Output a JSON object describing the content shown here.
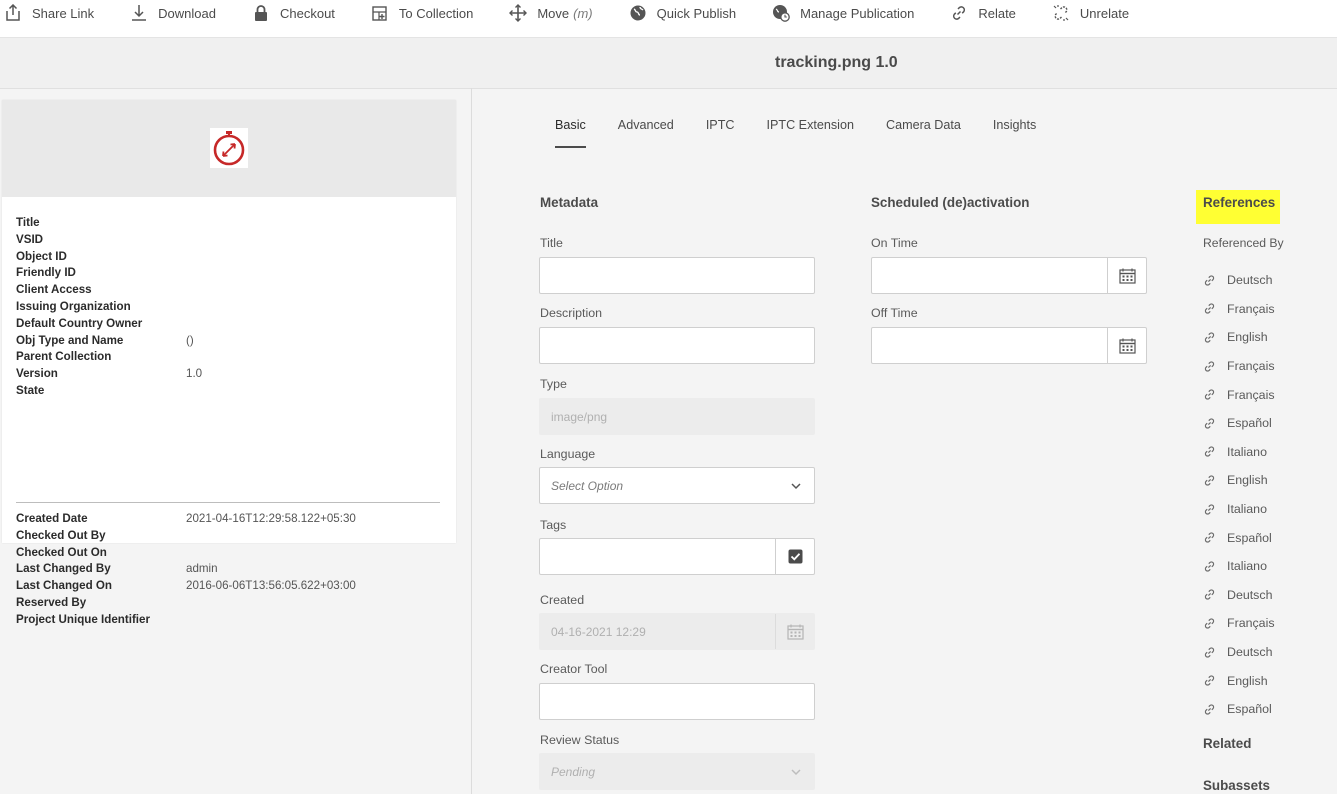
{
  "toolbar": {
    "share_link": "Share Link",
    "download": "Download",
    "checkout": "Checkout",
    "to_collection": "To Collection",
    "move": "Move",
    "move_hint": "(m)",
    "quick_publish": "Quick Publish",
    "manage_publication": "Manage Publication",
    "relate": "Relate",
    "unrelate": "Unrelate"
  },
  "header": {
    "title": "tracking.png 1.0"
  },
  "asset": {
    "thumbnail_icon": "stopwatch-icon",
    "properties": [
      {
        "label": "Title",
        "value": ""
      },
      {
        "label": "VSID",
        "value": ""
      },
      {
        "label": "Object ID",
        "value": ""
      },
      {
        "label": "Friendly ID",
        "value": ""
      },
      {
        "label": "Client Access",
        "value": ""
      },
      {
        "label": "Issuing Organization",
        "value": ""
      },
      {
        "label": "Default Country Owner",
        "value": ""
      },
      {
        "label": "Obj Type and Name",
        "value": "()"
      },
      {
        "label": "Parent Collection",
        "value": ""
      },
      {
        "label": "Version",
        "value": "1.0"
      },
      {
        "label": "State",
        "value": ""
      }
    ],
    "history": [
      {
        "label": "Created Date",
        "value": "2021-04-16T12:29:58.122+05:30"
      },
      {
        "label": "Checked Out By",
        "value": ""
      },
      {
        "label": "Checked Out On",
        "value": ""
      },
      {
        "label": "Last Changed By",
        "value": "admin"
      },
      {
        "label": "Last Changed On",
        "value": "2016-06-06T13:56:05.622+03:00"
      },
      {
        "label": "Reserved By",
        "value": ""
      },
      {
        "label": "Project Unique Identifier",
        "value": ""
      }
    ]
  },
  "tabs": [
    "Basic",
    "Advanced",
    "IPTC",
    "IPTC Extension",
    "Camera Data",
    "Insights"
  ],
  "active_tab": "Basic",
  "metadata": {
    "title": "Metadata",
    "fields": {
      "title": {
        "label": "Title",
        "value": ""
      },
      "description": {
        "label": "Description",
        "value": ""
      },
      "type": {
        "label": "Type",
        "value": "image/png"
      },
      "language": {
        "label": "Language",
        "placeholder": "Select Option"
      },
      "tags": {
        "label": "Tags",
        "value": ""
      },
      "created": {
        "label": "Created",
        "value": "04-16-2021 12:29"
      },
      "creator_tool": {
        "label": "Creator Tool",
        "value": ""
      },
      "review_status": {
        "label": "Review Status",
        "value": "Pending"
      }
    }
  },
  "scheduled": {
    "title": "Scheduled (de)activation",
    "on_time": {
      "label": "On Time",
      "value": ""
    },
    "off_time": {
      "label": "Off Time",
      "value": ""
    }
  },
  "references": {
    "title": "References",
    "highlight_color": "#ffff33",
    "referenced_by_label": "Referenced By",
    "items": [
      "Deutsch",
      "Français",
      "English",
      "Français",
      "Français",
      "Español",
      "Italiano",
      "English",
      "Italiano",
      "Español",
      "Italiano",
      "Deutsch",
      "Français",
      "Deutsch",
      "English",
      "Español"
    ],
    "related_label": "Related",
    "subassets_label": "Subassets"
  }
}
